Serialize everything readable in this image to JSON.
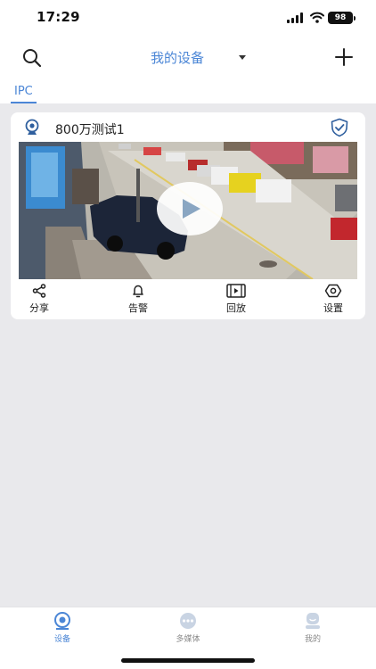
{
  "status_bar": {
    "time": "17:29",
    "battery": "98"
  },
  "header": {
    "title": "我的设备",
    "icons": [
      "search-icon",
      "chevron-down-icon",
      "plus-icon"
    ]
  },
  "tabs": {
    "active": "IPC"
  },
  "device": {
    "name": "800万测试1",
    "icons": [
      "camera-icon",
      "shield-check-icon",
      "play-icon"
    ],
    "actions": [
      {
        "label": "分享",
        "icon": "share-icon"
      },
      {
        "label": "告警",
        "icon": "bell-icon"
      },
      {
        "label": "回放",
        "icon": "film-icon"
      },
      {
        "label": "设置",
        "icon": "settings-icon"
      }
    ]
  },
  "tab_bar": {
    "items": [
      {
        "label": "设备",
        "icon": "device-icon",
        "active": true
      },
      {
        "label": "多媒体",
        "icon": "media-icon",
        "active": false
      },
      {
        "label": "我的",
        "icon": "profile-icon",
        "active": false
      }
    ]
  },
  "colors": {
    "accent": "#4b86d6",
    "background": "#e9e9ec",
    "card": "#ffffff"
  }
}
